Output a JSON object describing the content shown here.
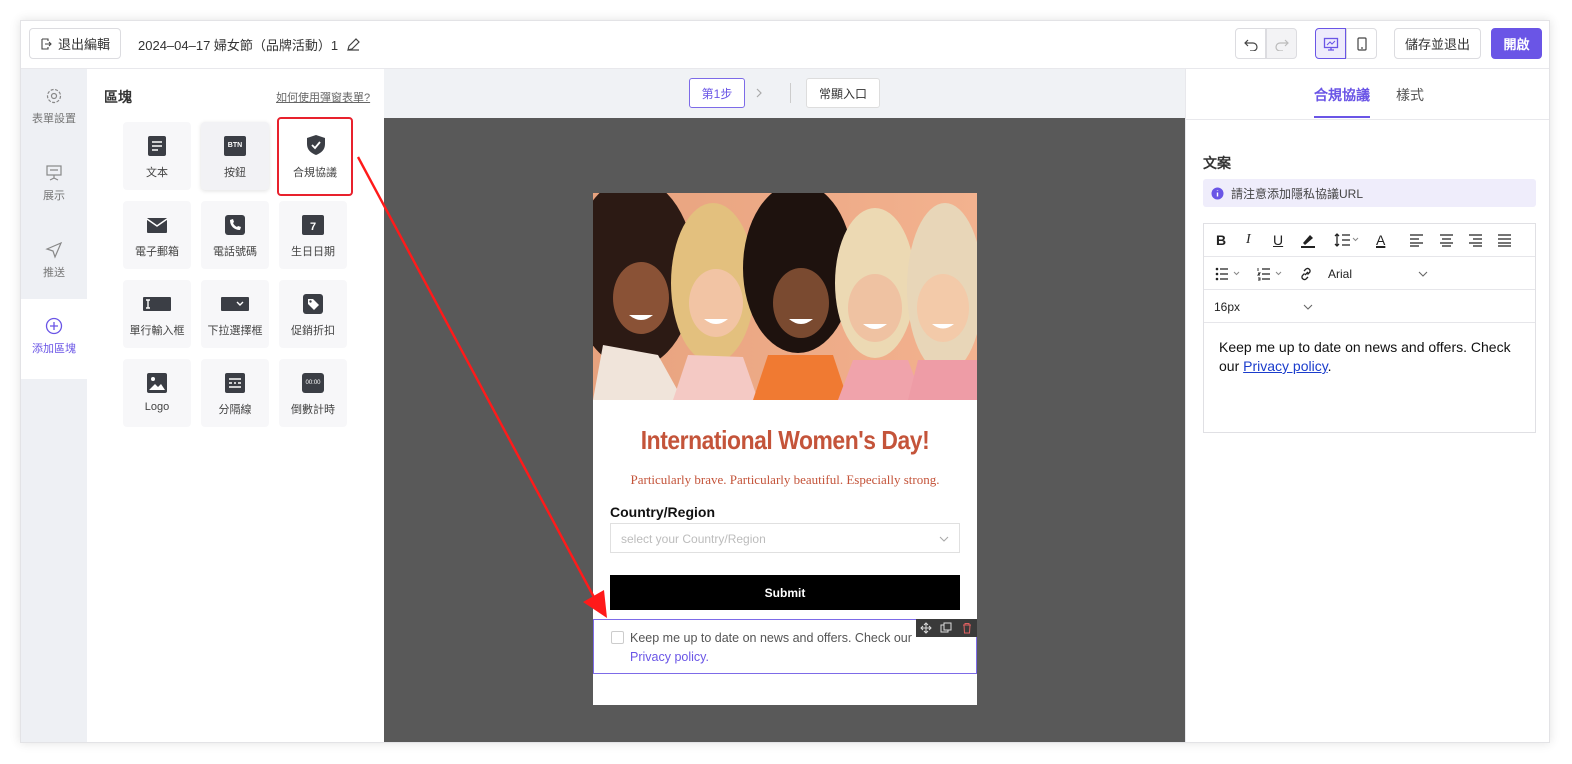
{
  "topbar": {
    "exit_label": "退出編輯",
    "doc_title": "2024–04–17 婦女節（品牌活動）1",
    "save_exit_label": "儲存並退出",
    "open_label": "開啟"
  },
  "leftnav": {
    "items": [
      {
        "label": "表單設置",
        "icon": "gear-icon"
      },
      {
        "label": "展示",
        "icon": "presentation-icon"
      },
      {
        "label": "推送",
        "icon": "send-icon"
      },
      {
        "label": "添加區塊",
        "icon": "plus-circle-icon"
      }
    ]
  },
  "blocks": {
    "title": "區塊",
    "help_link": "如何使用彈窗表單?",
    "tiles": [
      {
        "label": "文本",
        "icon": "text-icon"
      },
      {
        "label": "按鈕",
        "icon": "button-icon",
        "badge": "BTN"
      },
      {
        "label": "合規協議",
        "icon": "shield-check-icon"
      },
      {
        "label": "電子郵箱",
        "icon": "mail-icon"
      },
      {
        "label": "電話號碼",
        "icon": "phone-icon"
      },
      {
        "label": "生日日期",
        "icon": "calendar-icon",
        "day": "7"
      },
      {
        "label": "單行輸入框",
        "icon": "input-icon"
      },
      {
        "label": "下拉選擇框",
        "icon": "dropdown-icon"
      },
      {
        "label": "促銷折扣",
        "icon": "tag-icon"
      },
      {
        "label": "Logo",
        "icon": "image-icon"
      },
      {
        "label": "分隔線",
        "icon": "divider-icon"
      },
      {
        "label": "倒數計時",
        "icon": "countdown-icon",
        "digits": "00:00"
      }
    ]
  },
  "canvas": {
    "step_label": "第1步",
    "entry_label": "常顯入口"
  },
  "form": {
    "heading": "International Women's Day!",
    "subheading": "Particularly brave. Particularly beautiful. Especially strong.",
    "field_label": "Country/Region",
    "select_placeholder": "select your Country/Region",
    "submit_label": "Submit",
    "consent_text": "Keep me up to date on news and offers. Check our",
    "consent_link": "Privacy policy."
  },
  "rightpanel": {
    "tab_active": "合規協議",
    "tab_other": "樣式",
    "section_title": "文案",
    "notice": "請注意添加隱私協議URL",
    "font_family": "Arial",
    "font_size": "16px",
    "editor_text": "Keep me up to date on news and offers. Check our",
    "editor_link": "Privacy policy",
    "editor_end": "."
  },
  "colors": {
    "accent": "#6a55e6",
    "heading": "#c4543a",
    "highlight_border": "#e8212d",
    "canvas_bg": "#595959"
  }
}
